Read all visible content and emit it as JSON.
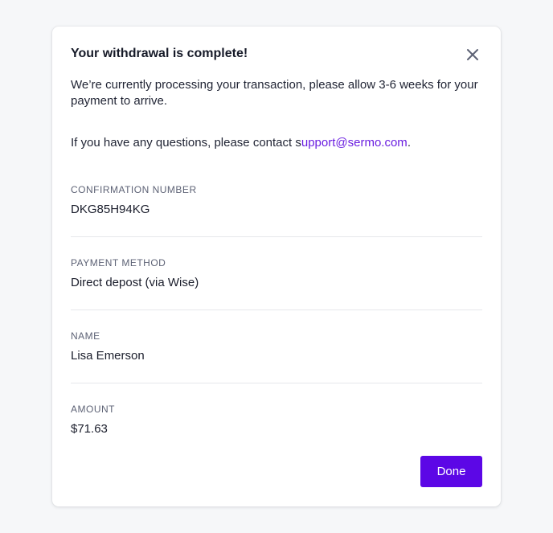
{
  "dialog": {
    "title": "Your withdrawal is complete!",
    "close_icon": "close-icon",
    "message": "We’re currently processing your transaction, please allow 3-6 weeks for your payment to arrive.",
    "contact_prefix": "If you have any questions, please contact s",
    "contact_link": "upport@sermo.com",
    "contact_suffix": ".",
    "fields": [
      {
        "label": "CONFIRMATION NUMBER",
        "value": "DKG85H94KG"
      },
      {
        "label": "PAYMENT METHOD",
        "value": "Direct depost (via Wise)"
      },
      {
        "label": "NAME",
        "value": "Lisa Emerson"
      },
      {
        "label": "AMOUNT",
        "value": "$71.63"
      }
    ],
    "done_label": "Done"
  },
  "colors": {
    "accent": "#5c07e6",
    "link": "#6a1de0",
    "background": "#f6f7f9",
    "label": "#5d6275"
  }
}
